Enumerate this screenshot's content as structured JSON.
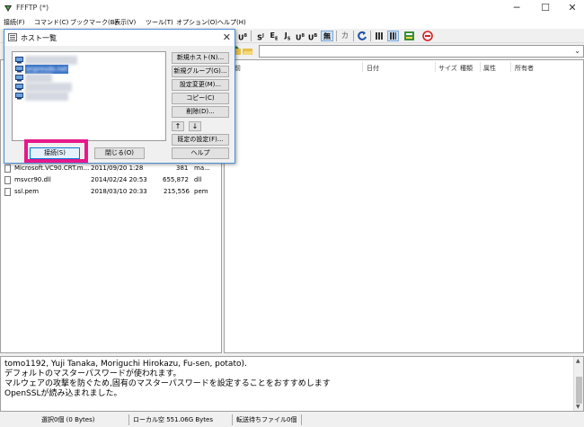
{
  "window": {
    "title": "FFFTP (*)"
  },
  "menu": [
    "接続(F)",
    "コマンド(C)",
    "ブックマーク(B)",
    "表示(V)",
    "ツール(T)",
    "オプション(O)",
    "ヘルプ(H)"
  ],
  "toolbar": {
    "buttons": [
      "U",
      "S",
      "E",
      "J",
      "U",
      "U",
      "無",
      "カ"
    ]
  },
  "remote": {
    "columns": [
      "前",
      "日付",
      "サイズ",
      "種類",
      "属性",
      "所有者"
    ]
  },
  "local": {
    "files": [
      {
        "name": "Microsoft.VC90.CRT.m...",
        "date": "2011/09/20 1:28",
        "size": "381",
        "type": "ma..."
      },
      {
        "name": "msvcr90.dll",
        "date": "2014/02/24 20:53",
        "size": "655,872",
        "type": "dll"
      },
      {
        "name": "ssl.pem",
        "date": "2018/03/10 20:33",
        "size": "215,556",
        "type": "pem"
      }
    ]
  },
  "dialog": {
    "title": "ホスト一覧",
    "selected_host": "onpresdo.net",
    "buttons": {
      "new_host": "新規ホスト(N)...",
      "new_group": "新規グループ(G)...",
      "edit": "設定変更(M)...",
      "copy": "コピー(C)",
      "delete": "削除(D)...",
      "up": "↑",
      "down": "↓",
      "default": "既定の設定(F)...",
      "help": "ヘルプ",
      "connect": "接続(S)",
      "close": "閉じる(O)"
    }
  },
  "log": [
    "tomo1192, Yuji Tanaka, Moriguchi Hirokazu, Fu-sen, potato).",
    "デフォルトのマスターパスワードが使われます。",
    "マルウェアの攻撃を防ぐため,固有のマスターパスワードを設定することをおすすめします",
    "OpenSSLが読み込まれました。"
  ],
  "status": {
    "selected": "選択0個 (0 Bytes)",
    "local_free": "ローカル空 551.06G Bytes",
    "queue": "転送待ちファイル0個"
  },
  "colors": {
    "highlight": "#e6198b",
    "selection": "#3a74c8",
    "dialog_border": "#4d8fd6"
  }
}
